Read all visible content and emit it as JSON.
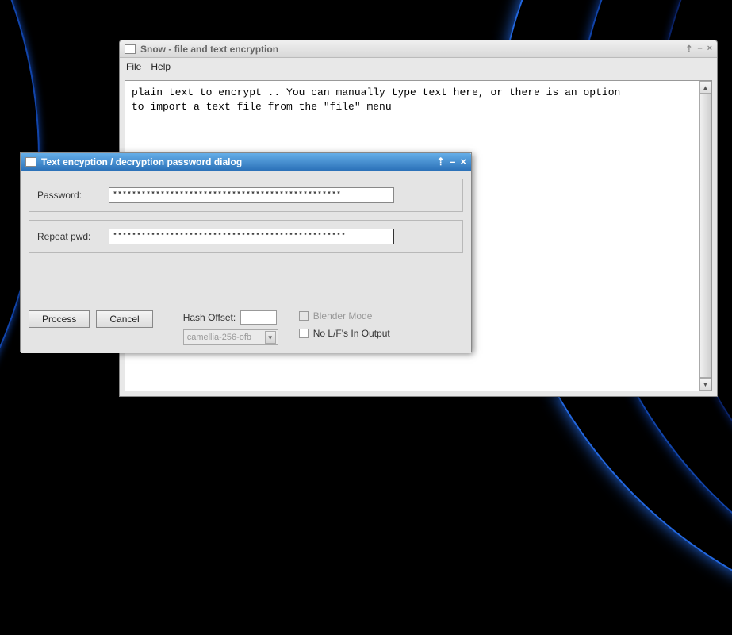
{
  "main": {
    "title": "Snow - file and text encryption",
    "menu": {
      "file": "File",
      "help": "Help"
    },
    "text": "plain text to encrypt .. You can manually type text here, or there is an option\nto import a text file from the \"file\" menu"
  },
  "dialog": {
    "title": "Text encyption / decryption password dialog",
    "password_label": "Password:",
    "password_value": "************************************************",
    "repeat_label": "Repeat pwd:",
    "repeat_value": "*************************************************",
    "process": "Process",
    "cancel": "Cancel",
    "hash_offset_label": "Hash Offset:",
    "hash_offset_value": "",
    "cipher": "camellia-256-ofb",
    "blender_mode": "Blender Mode",
    "no_lfs": "No L/F's In Output"
  }
}
